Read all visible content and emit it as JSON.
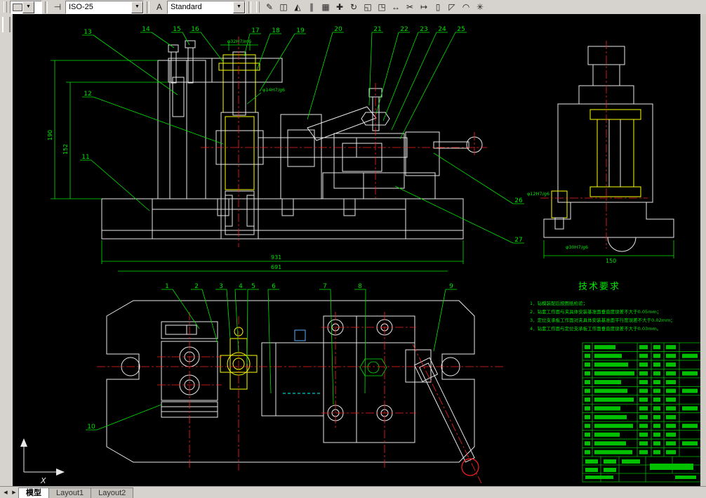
{
  "toolbar": {
    "dim_style": {
      "value": "ISO-25"
    },
    "text_style": {
      "value": "Standard"
    },
    "icons": [
      {
        "name": "erase",
        "glyph": "✎"
      },
      {
        "name": "copy",
        "glyph": "◫"
      },
      {
        "name": "mirror",
        "glyph": "◭"
      },
      {
        "name": "offset",
        "glyph": "∥"
      },
      {
        "name": "array",
        "glyph": "▦"
      },
      {
        "name": "move",
        "glyph": "✚"
      },
      {
        "name": "rotate",
        "glyph": "↻"
      },
      {
        "name": "scale",
        "glyph": "◱"
      },
      {
        "name": "stretch",
        "glyph": "◳"
      },
      {
        "name": "lengthen",
        "glyph": "↔"
      },
      {
        "name": "trim",
        "glyph": "✂"
      },
      {
        "name": "extend",
        "glyph": "↦"
      },
      {
        "name": "break",
        "glyph": "▯"
      },
      {
        "name": "chamfer",
        "glyph": "◸"
      },
      {
        "name": "fillet",
        "glyph": "◠"
      },
      {
        "name": "explode",
        "glyph": "✳"
      }
    ]
  },
  "canvas": {
    "callouts": [
      "1",
      "2",
      "3",
      "4",
      "5",
      "6",
      "7",
      "8",
      "9",
      "10",
      "11",
      "12",
      "13",
      "14",
      "15",
      "16",
      "17",
      "18",
      "19",
      "20",
      "21",
      "22",
      "23",
      "24",
      "25",
      "26",
      "27"
    ],
    "dimensions": {
      "total_width": "931",
      "inner_width": "691",
      "left_height_outer": "190",
      "left_height_inner": "152",
      "side_width": "150",
      "fit_top": "φ32H7/m6",
      "fit_bushing": "φ14H7/g6",
      "fit_side_pin": "φ12H7/g6",
      "fit_side_bore": "φ30H7/g6"
    },
    "tech_requirements": {
      "title": "技术要求",
      "items": [
        "1．钻模装配后按图纸检验；",
        "2．钻套工作面与夹具体安装基准面垂直度误差不大于0.05mm；",
        "3．定位支承板工作面对夹具体安装基准面平行度误差不大于0.02mm；",
        "4．钻套工作面与定位支承板工作面垂直度误差不大于0.03mm。"
      ]
    },
    "ucs": {
      "x_label": "X"
    }
  },
  "bom": {
    "rows": 13
  },
  "tabs": [
    {
      "label": "模型",
      "active": true
    },
    {
      "label": "Layout1",
      "active": false
    },
    {
      "label": "Layout2",
      "active": false
    }
  ],
  "colors": {
    "outline": "#e8e8e8",
    "annotation": "#00e400",
    "centerline": "#ff2020",
    "section_brass": "#ffff00",
    "hidden": "#00ffff",
    "canvas_bg": "#000000",
    "chrome": "#d6d3ce"
  }
}
